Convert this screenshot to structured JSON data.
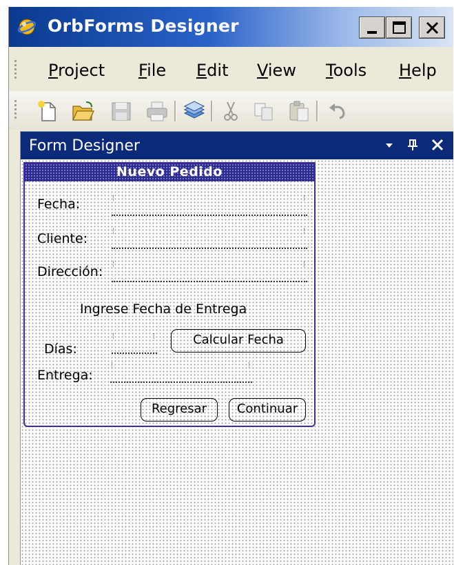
{
  "window": {
    "title": "OrbForms Designer",
    "controls": [
      "minimize-icon",
      "maximize-icon",
      "close-icon"
    ]
  },
  "menu": {
    "items": [
      {
        "pre": "",
        "key": "P",
        "post": "roject"
      },
      {
        "pre": "",
        "key": "F",
        "post": "ile"
      },
      {
        "pre": "",
        "key": "E",
        "post": "dit"
      },
      {
        "pre": "",
        "key": "V",
        "post": "iew"
      },
      {
        "pre": "",
        "key": "T",
        "post": "ools"
      },
      {
        "pre": "",
        "key": "H",
        "post": "elp"
      }
    ]
  },
  "toolbar": {
    "buttons": [
      "new-icon",
      "open-icon",
      "save-icon",
      "print-icon",
      "layers-icon",
      "cut-icon",
      "copy-icon",
      "paste-icon",
      "undo-icon"
    ]
  },
  "panel": {
    "title": "Form Designer",
    "controls": [
      "dropdown-icon",
      "pin-icon",
      "close-icon"
    ]
  },
  "form": {
    "title": "Nuevo Pedido",
    "labels": {
      "fecha": "Fecha:",
      "cliente": "Cliente:",
      "direccion": "Dirección:",
      "ingrese": "Ingrese Fecha de Entrega",
      "dias": "Días:",
      "entrega": "Entrega:"
    },
    "buttons": {
      "calcular": "Calcular Fecha",
      "regresar": "Regresar",
      "continuar": "Continuar"
    }
  },
  "colors": {
    "titlebar": "#0a3a8f",
    "panel_header": "#0c2a7a",
    "form_border": "#3b2d9e"
  }
}
